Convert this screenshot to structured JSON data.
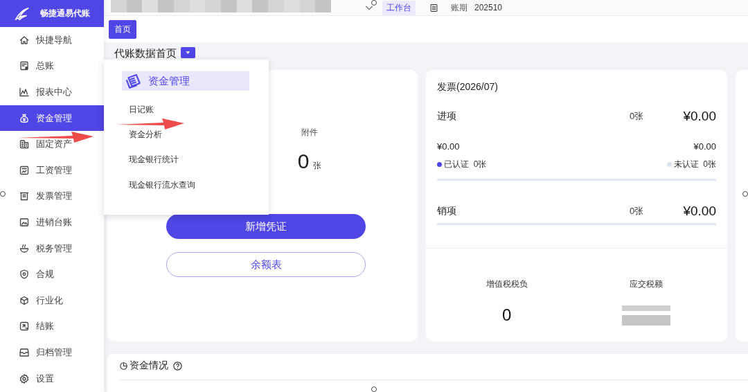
{
  "sidebar": {
    "brand": "畅捷通易代账",
    "items": [
      {
        "label": "快捷导航",
        "selected": false
      },
      {
        "label": "总账",
        "selected": false
      },
      {
        "label": "报表中心",
        "selected": false
      },
      {
        "label": "资金管理",
        "selected": true
      },
      {
        "label": "固定资产",
        "selected": false
      },
      {
        "label": "工资管理",
        "selected": false
      },
      {
        "label": "发票管理",
        "selected": false
      },
      {
        "label": "进销台账",
        "selected": false
      },
      {
        "label": "税务管理",
        "selected": false
      },
      {
        "label": "合规",
        "selected": false
      },
      {
        "label": "行业化",
        "selected": false
      },
      {
        "label": "结账",
        "selected": false
      },
      {
        "label": "归档管理",
        "selected": false
      },
      {
        "label": "设置",
        "selected": false
      }
    ]
  },
  "topbar": {
    "workbench": "工作台",
    "period_label": "账期",
    "period": "202510"
  },
  "tabs": [
    {
      "label": "首页",
      "selected": true
    }
  ],
  "page_title": "代账数据首页",
  "menu": {
    "title": "资金管理",
    "items": [
      "日记账",
      "资金分析",
      "现金银行统计",
      "现金银行流水查询"
    ]
  },
  "voucher_card": {
    "attachment_label": "附件",
    "attachment_count": "0",
    "unit": "张",
    "buttons": [
      {
        "label": "新增凭证",
        "kind": "primary"
      },
      {
        "label": "余额表",
        "kind": "outline"
      }
    ]
  },
  "invoice_card": {
    "title": "发票(2026/07)",
    "input": {
      "label": "进项",
      "count": "0张",
      "amount": "¥0.00",
      "certified_amount": "¥0.00",
      "uncertified_amount": "¥0.00"
    },
    "legend": [
      {
        "label": "已认证",
        "count": "0张",
        "color": "#4f46e5"
      },
      {
        "label": "未认证",
        "count": "0张",
        "color": "#dce4f2"
      }
    ],
    "output": {
      "label": "销项",
      "count": "0张",
      "amount": "¥0.00"
    },
    "vat_burden_label": "增值税税负",
    "vat_burden": "0",
    "tax_payable_label": "应交税额"
  },
  "funds_section": {
    "title": "资金情况"
  }
}
